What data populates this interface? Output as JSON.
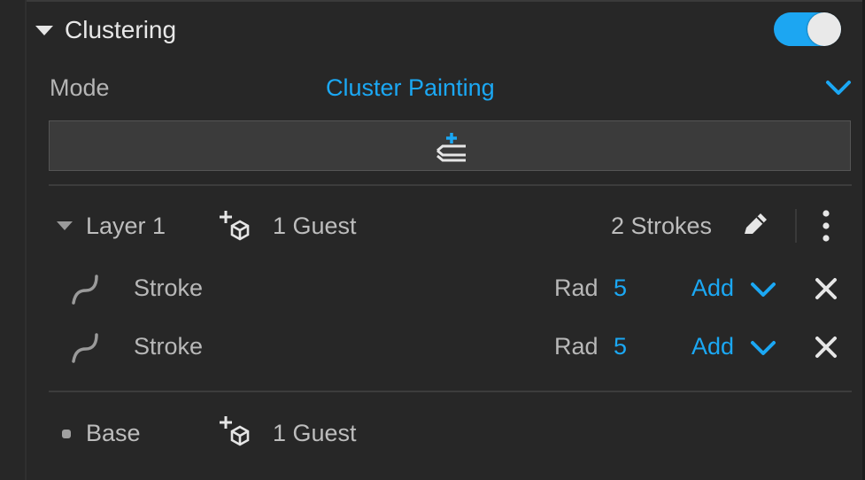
{
  "section": {
    "title": "Clustering",
    "enabled": true,
    "accent_color": "#1ba8f4"
  },
  "mode": {
    "label": "Mode",
    "value": "Cluster Painting"
  },
  "add_layer_button": {
    "icon": "add-layer-icon"
  },
  "layer": {
    "name": "Layer 1",
    "guests": "1 Guest",
    "strokes_count": "2 Strokes",
    "strokes": [
      {
        "label": "Stroke",
        "rad_label": "Rad",
        "rad_value": "5",
        "mode_label": "Add"
      },
      {
        "label": "Stroke",
        "rad_label": "Rad",
        "rad_value": "5",
        "mode_label": "Add"
      }
    ]
  },
  "base": {
    "name": "Base",
    "guests": "1 Guest"
  }
}
